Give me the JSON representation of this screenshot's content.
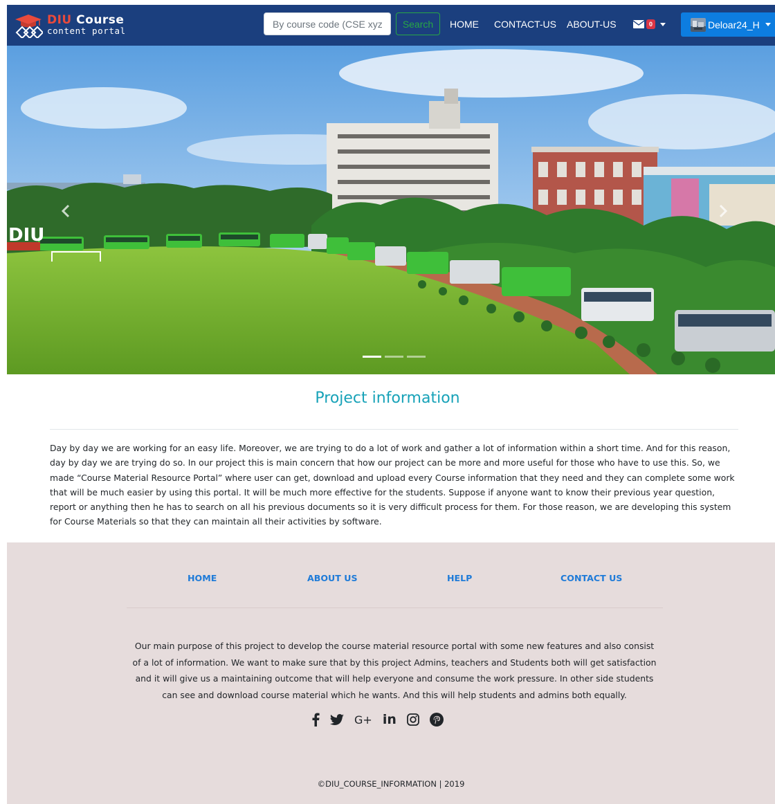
{
  "brand": {
    "name_part1": "DIU",
    "name_part2": " Course",
    "subtitle": "content portal"
  },
  "search": {
    "placeholder": "By course code (CSE xyz)",
    "button_label": "Search"
  },
  "nav": {
    "home": "HOME",
    "contact": "CONTACT-US",
    "about": "ABOUT-US"
  },
  "messages": {
    "count": "0"
  },
  "user": {
    "name": "Deloar24_H"
  },
  "carousel": {
    "slide_count": 3,
    "active_index": 0,
    "watermark": "DIU"
  },
  "project": {
    "title": "Project information",
    "body": "Day by day we are working for an easy life. Moreover, we are trying to do a lot of work and gather a lot of information within a short time. And for this reason, day by day we are trying do so. In our project this is main concern that how our project can be more and more useful for those who have to use this. So, we made “Course Material Resource Portal” where user can get, download and upload every Course information that they need and they can complete some work that will be much easier by using this portal. It will be much more effective for the students. Suppose if anyone want to know their previous year question, report or anything then he has to search on all his previous documents so it is very difficult process for them. For those reason, we are developing this system for Course Materials so that they can maintain all their activities by software."
  },
  "footer": {
    "links": {
      "home": "HOME",
      "about": "ABOUT US",
      "help": "HELP",
      "contact": "CONTACT US"
    },
    "text": "Our main purpose of this project to develop the course material resource portal with some new features and also consist of a lot of information. We want to make sure that by this project Admins, teachers and Students both will get satisfaction and it will give us a maintaining outcome that will help everyone and consume the work pressure. In other side students can see and download course material which he wants. And this will help students and admins both equally.",
    "social_icons": [
      "facebook-icon",
      "twitter-icon",
      "google-plus-icon",
      "linkedin-icon",
      "instagram-icon",
      "pinterest-icon"
    ],
    "social_glyphs": {
      "google_plus": "G+",
      "linkedin": "in"
    },
    "copyright": "©DIU_COURSE_INFORMATION | 2019"
  },
  "colors": {
    "navbar": "#1b3f7e",
    "brand_accent": "#e84a3c",
    "search_button": "#28a745",
    "user_button": "#0d7de0",
    "title": "#17a2b8",
    "footer_bg": "#e6dcdc",
    "footer_link": "#1f7bd8",
    "badge": "#dc3545"
  }
}
